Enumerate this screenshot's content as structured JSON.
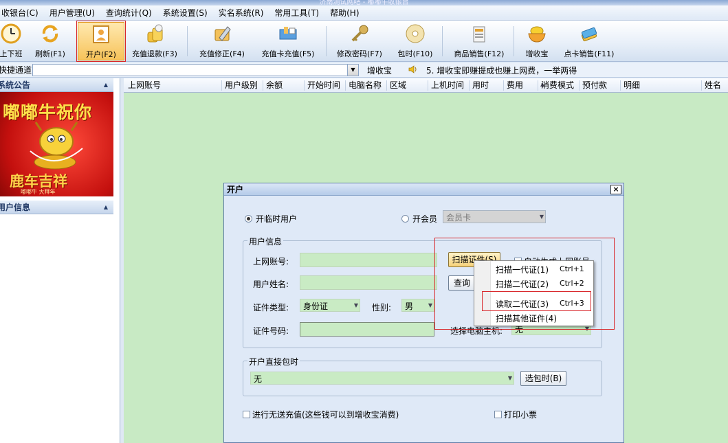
{
  "window": {
    "title": "济南测试网吧 - 嘟嘟牛收银台"
  },
  "menu": [
    "收银台(C)",
    "用户管理(U)",
    "查询统计(Q)",
    "系统设置(S)",
    "实名系统(R)",
    "常用工具(T)",
    "帮助(H)"
  ],
  "toolbar": {
    "items": [
      {
        "label": "上下班",
        "icon": "clock-icon"
      },
      {
        "label": "刷新(F1)",
        "icon": "refresh-icon"
      },
      {
        "label": "开户(F2)",
        "icon": "open-account-icon"
      },
      {
        "label": "充值退款(F3)",
        "icon": "coins-icon"
      },
      {
        "label": "充值修正(F4)",
        "icon": "edit-pencil-icon"
      },
      {
        "label": "充值卡充值(F5)",
        "icon": "recharge-card-icon"
      },
      {
        "label": "修改密码(F7)",
        "icon": "key-icon"
      },
      {
        "label": "包时(F10)",
        "icon": "disc-icon"
      },
      {
        "label": "商品销售(F12)",
        "icon": "goods-icon"
      },
      {
        "label": "增收宝",
        "icon": "treasure-bowl-icon"
      },
      {
        "label": "点卡销售(F11)",
        "icon": "card-stack-icon"
      }
    ]
  },
  "quickbar": {
    "label": "快捷通道",
    "zsb_label": "增收宝",
    "notice": "5. 增收宝即赚提成也赚上网费，一举两得"
  },
  "leftpane": {
    "announcement_title": "系统公告",
    "banner_title": "嘟嘟牛祝你",
    "banner_bottom": "鹿车吉祥",
    "banner_foot": "嘟嘟牛 大拜年",
    "user_info_title": "用户信息"
  },
  "grid": {
    "columns": [
      "上网账号",
      "用户级别",
      "余额",
      "开始时间",
      "电脑名称",
      "区域",
      "上机时间",
      "用时",
      "费用",
      "消费模式",
      "预付款",
      "明细",
      "姓名"
    ]
  },
  "dialog": {
    "title": "开户",
    "close": "×",
    "radio_temp": "开临时用户",
    "radio_member": "开会员",
    "member_card_value": "会员卡",
    "user_info_group": "用户信息",
    "account_label": "上网账号:",
    "name_label": "用户姓名:",
    "id_type_label": "证件类型:",
    "id_type_value": "身份证",
    "gender_label": "性别:",
    "gender_value": "男",
    "id_number_label": "证件号码:",
    "scan_button": "扫描证件(S)",
    "query_button": "查询",
    "auto_gen_label": "自动生成上网账号",
    "select_pc_label": "选择电脑主机:",
    "select_pc_value": "无",
    "package_group": "开户直接包时",
    "package_value": "无",
    "select_package_button": "选包时(B)",
    "free_recharge_label": "进行无送充值(这些钱可以到增收宝消费)",
    "print_receipt_label": "打印小票"
  },
  "context_menu": {
    "items": [
      {
        "label": "扫描一代证(1)",
        "shortcut": "Ctrl+1"
      },
      {
        "label": "扫描二代证(2)",
        "shortcut": "Ctrl+2"
      },
      {
        "label": "读取二代证(3)",
        "shortcut": "Ctrl+3"
      },
      {
        "label": "扫描其他证件(4)",
        "shortcut": ""
      }
    ]
  },
  "colors": {
    "highlight_red": "#d8262a",
    "grid_green": "#c8eac4",
    "field_green": "#c9ebc4",
    "active_tab_orange": "#f7c35a"
  }
}
